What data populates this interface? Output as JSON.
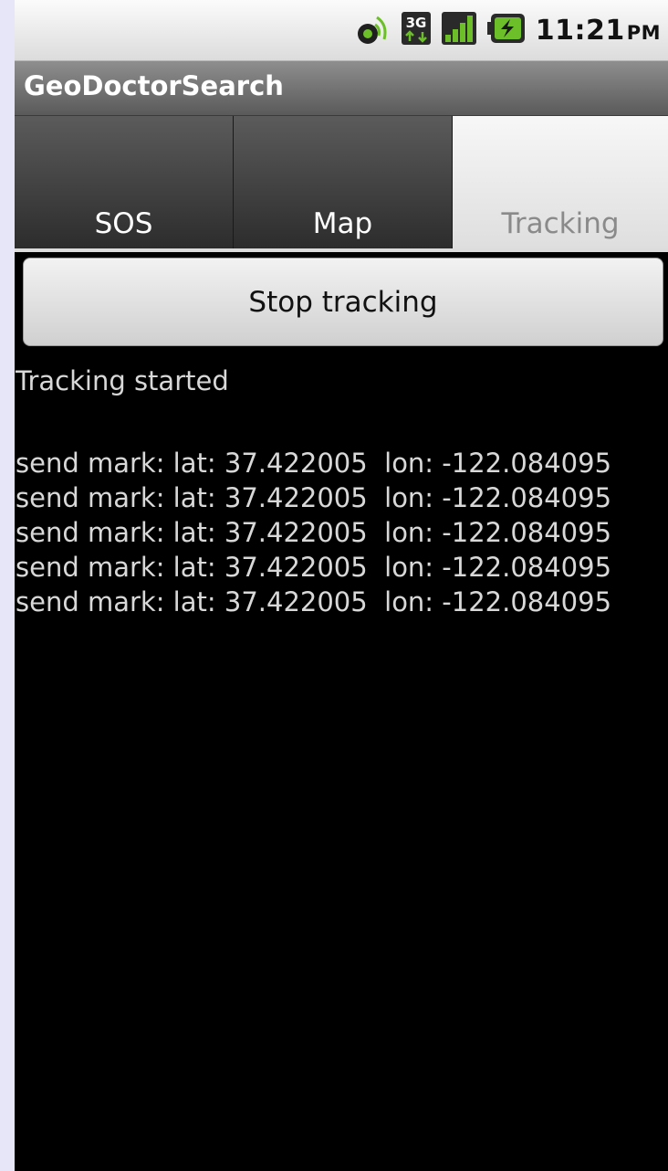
{
  "status_bar": {
    "time": "11:21",
    "ampm": "PM",
    "icons": [
      "gps-icon",
      "3g-data-icon",
      "signal-icon",
      "battery-charging-icon"
    ],
    "network_label": "3G"
  },
  "app": {
    "title": "GeoDoctorSearch"
  },
  "tabs": [
    {
      "label": "SOS",
      "selected": false
    },
    {
      "label": "Map",
      "selected": false
    },
    {
      "label": "Tracking",
      "selected": true
    }
  ],
  "tracking": {
    "button_label": "Stop tracking",
    "status": "Tracking started",
    "log": [
      "send mark: lat: 37.422005  lon: -122.084095",
      "send mark: lat: 37.422005  lon: -122.084095",
      "send mark: lat: 37.422005  lon: -122.084095",
      "send mark: lat: 37.422005  lon: -122.084095",
      "send mark: lat: 37.422005  lon: -122.084095"
    ]
  }
}
